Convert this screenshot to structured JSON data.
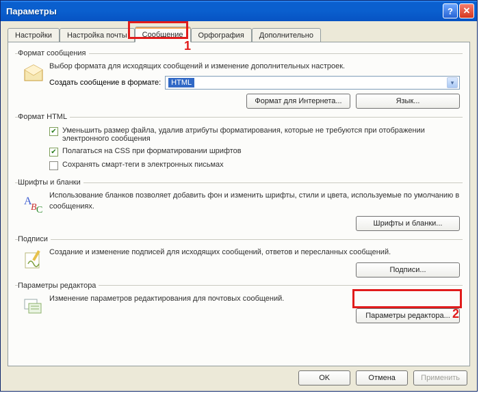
{
  "window": {
    "title": "Параметры"
  },
  "tabs": {
    "items": [
      {
        "label": "Настройки"
      },
      {
        "label": "Настройка почты"
      },
      {
        "label": "Сообщение"
      },
      {
        "label": "Орфография"
      },
      {
        "label": "Дополнительно"
      }
    ],
    "active_index": 2
  },
  "groups": {
    "message_format": {
      "legend": "Формат сообщения",
      "desc": "Выбор формата для исходящих сообщений и изменение дополнительных настроек.",
      "compose_label": "Создать сообщение в формате:",
      "compose_value": "HTML",
      "btn_internet": "Формат для Интернета...",
      "btn_lang": "Язык..."
    },
    "html_format": {
      "legend": "Формат HTML",
      "chk1": "Уменьшить размер файла, удалив атрибуты форматирования, которые не требуются при отображении электронного сообщения",
      "chk2": "Полагаться на CSS при форматировании шрифтов",
      "chk3": "Сохранять смарт-теги в электронных письмах"
    },
    "fonts": {
      "legend": "Шрифты и бланки",
      "desc": "Использование бланков позволяет добавить фон и изменить шрифты, стили и цвета, используемые по умолчанию в сообщениях.",
      "btn": "Шрифты и бланки..."
    },
    "signatures": {
      "legend": "Подписи",
      "desc": "Создание и изменение подписей для исходящих сообщений, ответов и пересланных сообщений.",
      "btn": "Подписи..."
    },
    "editor": {
      "legend": "Параметры редактора",
      "desc": "Изменение параметров редактирования для почтовых сообщений.",
      "btn": "Параметры редактора..."
    }
  },
  "footer": {
    "ok": "OK",
    "cancel": "Отмена",
    "apply": "Применить"
  },
  "callouts": {
    "one": "1",
    "two": "2"
  }
}
